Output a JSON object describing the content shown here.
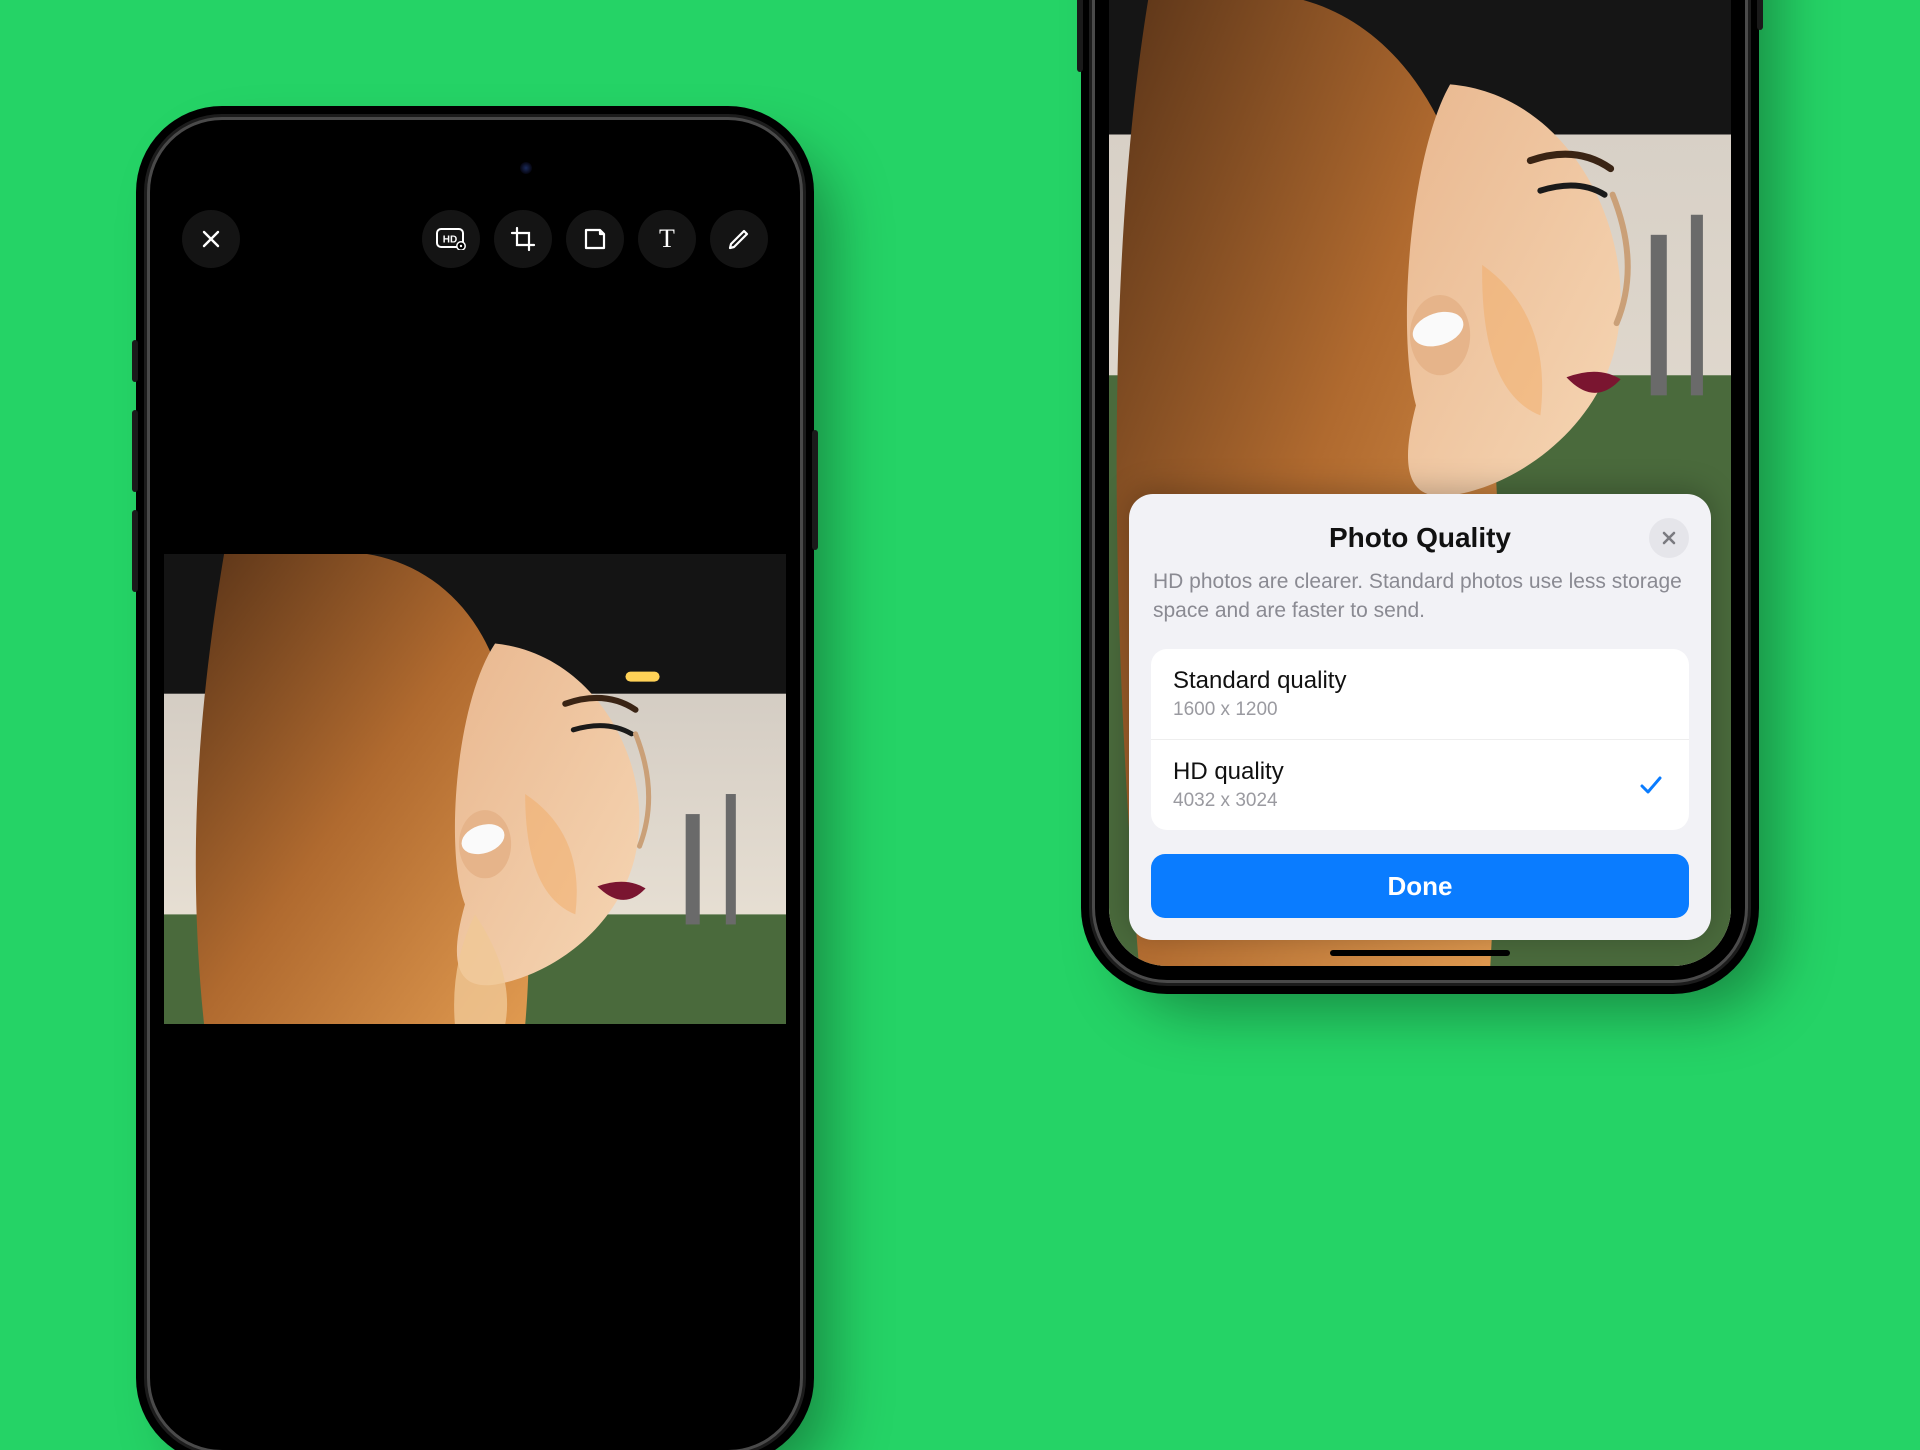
{
  "background_color": "#25d366",
  "left_phone": {
    "toolbar": {
      "close_icon": "close",
      "tools": [
        {
          "name": "hd-settings-icon"
        },
        {
          "name": "crop-rotate-icon"
        },
        {
          "name": "sticker-icon"
        },
        {
          "name": "text-icon",
          "glyph": "T"
        },
        {
          "name": "draw-icon"
        }
      ]
    }
  },
  "right_phone": {
    "sheet": {
      "title": "Photo Quality",
      "description": "HD photos are clearer. Standard photos use less storage space and are faster to send.",
      "options": [
        {
          "label": "Standard quality",
          "sub": "1600 x 1200",
          "selected": false
        },
        {
          "label": "HD quality",
          "sub": "4032 x 3024",
          "selected": true
        }
      ],
      "done_label": "Done"
    }
  }
}
